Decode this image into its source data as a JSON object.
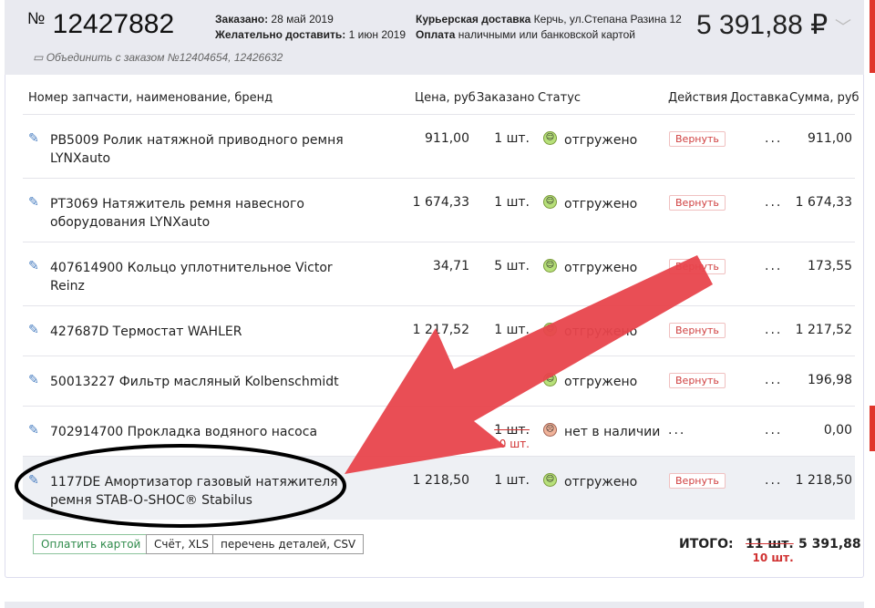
{
  "order": {
    "number_prefix": "№",
    "number": "12427882",
    "ordered_label": "Заказано:",
    "ordered_date": "28 май 2019",
    "desired_label": "Желательно доставить:",
    "desired_date": "1 июн 2019",
    "delivery_label": "Курьерская доставка",
    "delivery_address": "Керчь, ул.Степана Разина 12",
    "payment_label": "Оплата",
    "payment_text": "наличными или банковской картой",
    "total": "5 391,88 ₽",
    "merge_text": "Объединить с заказом №12404654, 12426632"
  },
  "columns": [
    "Номер запчасти, наименование, бренд",
    "Цена, руб",
    "Заказано",
    "Статус",
    "Действия",
    "Доставка",
    "Сумма, руб"
  ],
  "rows": [
    {
      "name": "PB5009 Ролик натяжной приводного ремня LYNXauto",
      "price": "911,00",
      "qty": "1 шт.",
      "status": "отгружено",
      "action": "Вернуть",
      "delivery": "...",
      "sum": "911,00"
    },
    {
      "name": "PT3069 Натяжитель ремня навесного оборудования LYNXauto",
      "price": "1 674,33",
      "qty": "1 шт.",
      "status": "отгружено",
      "action": "Вернуть",
      "delivery": "...",
      "sum": "1 674,33"
    },
    {
      "name": "407614900 Кольцо уплотнительное Victor Reinz",
      "price": "34,71",
      "qty": "5 шт.",
      "status": "отгружено",
      "action": "Вернуть",
      "delivery": "...",
      "sum": "173,55"
    },
    {
      "name": "427687D Термостат WAHLER",
      "price": "1 217,52",
      "qty": "1 шт.",
      "status": "отгружено",
      "action": "Вернуть",
      "delivery": "...",
      "sum": "1 217,52"
    },
    {
      "name": "50013227 Фильтр масляный Kolbenschmidt",
      "price": "",
      "qty": "",
      "status": "отгружено",
      "action": "Вернуть",
      "delivery": "...",
      "sum": "196,98"
    },
    {
      "name": "702914700 Прокладка водяного насоса",
      "price": "",
      "qty": "1 шт.",
      "qty_new": "0 шт.",
      "status": "нет в наличии",
      "action": "...",
      "delivery": "...",
      "sum": "0,00"
    },
    {
      "name": "1177DE Амортизатор газовый натяжителя ремня STAB-O-SHOC® Stabilus",
      "price": "1 218,50",
      "qty": "1 шт.",
      "status": "отгружено",
      "action": "Вернуть",
      "delivery": "...",
      "sum": "1 218,50"
    }
  ],
  "footer": {
    "pay_button": "Оплатить картой",
    "xls_button": "Счёт, XLS",
    "csv_button": "перечень деталей, CSV",
    "total_label": "ИТОГО:",
    "total_qty_old": "11 шт.",
    "total_qty_new": "10 шт.",
    "total_sum": "5 391,88"
  },
  "colors": {
    "accent_red": "#e0352a",
    "arrow": "#e8444c",
    "header_bg": "#e9eaf0"
  }
}
